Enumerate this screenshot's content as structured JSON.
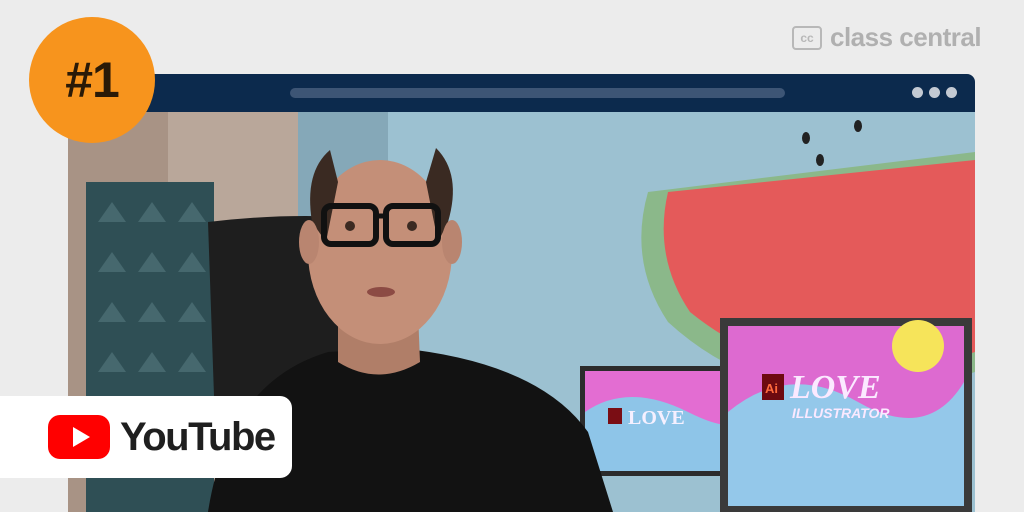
{
  "brand": {
    "icon": "cc-logo-icon",
    "icon_text": "cc",
    "name": "class central"
  },
  "rank_badge": {
    "text": "#1",
    "color": "#f7941d"
  },
  "browser": {
    "titlebar_color": "#0c2a4d",
    "menu_icon": "more-dots-icon"
  },
  "video": {
    "monitor_large_text": "LOVE",
    "monitor_large_sub": "ILLUSTRATOR",
    "monitor_small_text": "LOVE",
    "ai_logo": "Ai"
  },
  "platform": {
    "name": "YouTube",
    "icon": "youtube-play-icon",
    "color": "#ff0000"
  }
}
